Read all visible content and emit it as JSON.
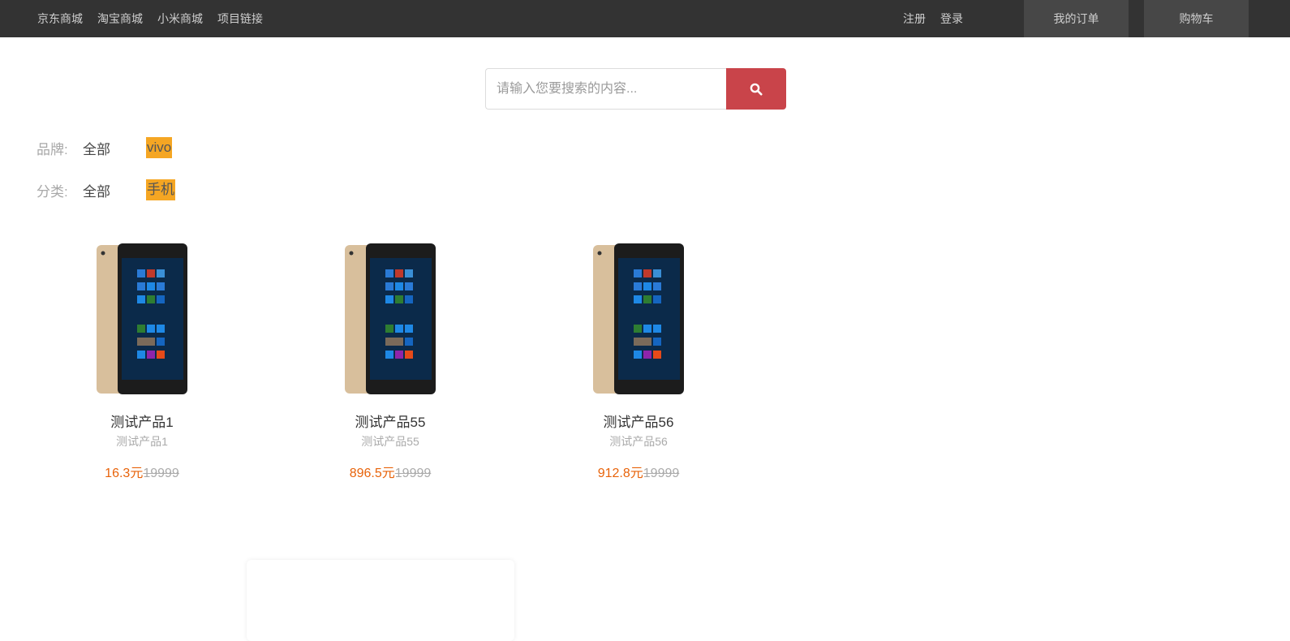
{
  "nav": {
    "links": [
      "京东商城",
      "淘宝商城",
      "小米商城",
      "项目链接"
    ],
    "register": "注册",
    "login": "登录",
    "orders": "我的订单",
    "cart": "购物车"
  },
  "search": {
    "placeholder": "请输入您要搜索的内容...",
    "value": "",
    "button_icon": "search-icon",
    "button_color": "#c9444a"
  },
  "filters": {
    "brand": {
      "label": "品牌:",
      "all": "全部",
      "selected": "vivo"
    },
    "category": {
      "label": "分类:",
      "all": "全部",
      "selected": "手机"
    },
    "highlight_color": "#f5a623"
  },
  "products": [
    {
      "name": "测试产品1",
      "desc": "测试产品1",
      "price": "16.3元",
      "old_price": "19999"
    },
    {
      "name": "测试产品55",
      "desc": "测试产品55",
      "price": "896.5元",
      "old_price": "19999"
    },
    {
      "name": "测试产品56",
      "desc": "测试产品56",
      "price": "912.8元",
      "old_price": "19999"
    }
  ],
  "colors": {
    "topbar": "#333333",
    "price": "#e8630a"
  }
}
